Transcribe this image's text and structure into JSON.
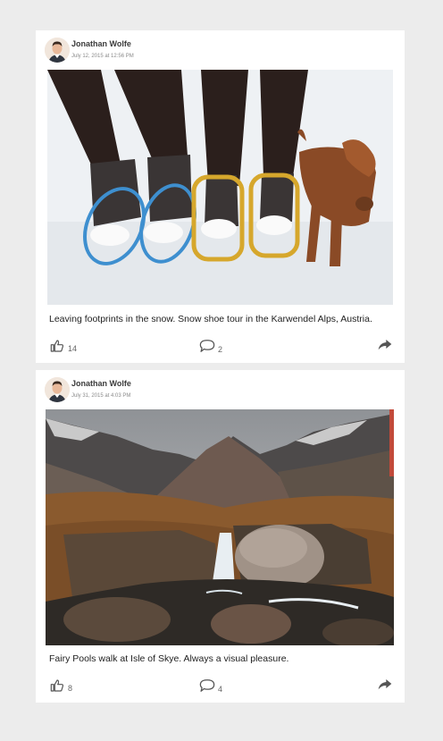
{
  "posts": [
    {
      "author": "Jonathan Wolfe",
      "date": "July 12, 2015 at 12:56 PM",
      "caption": "Leaving footprints in the snow. Snow shoe tour in the Karwendel Alps, Austria.",
      "likes": "14",
      "comments": "2",
      "icons": {
        "like": "thumbs-up-icon",
        "comment": "speech-bubble-icon",
        "share": "share-arrow-icon"
      }
    },
    {
      "author": "Jonathan Wolfe",
      "date": "July 31, 2015 at 4:03 PM",
      "caption": "Fairy Pools walk at Isle of Skye. Always a visual pleasure.",
      "likes": "8",
      "comments": "4",
      "icons": {
        "like": "thumbs-up-icon",
        "comment": "speech-bubble-icon",
        "share": "share-arrow-icon"
      }
    }
  ],
  "colors": {
    "page_background": "#ececec",
    "card_background": "#ffffff",
    "icon": "#555555"
  }
}
